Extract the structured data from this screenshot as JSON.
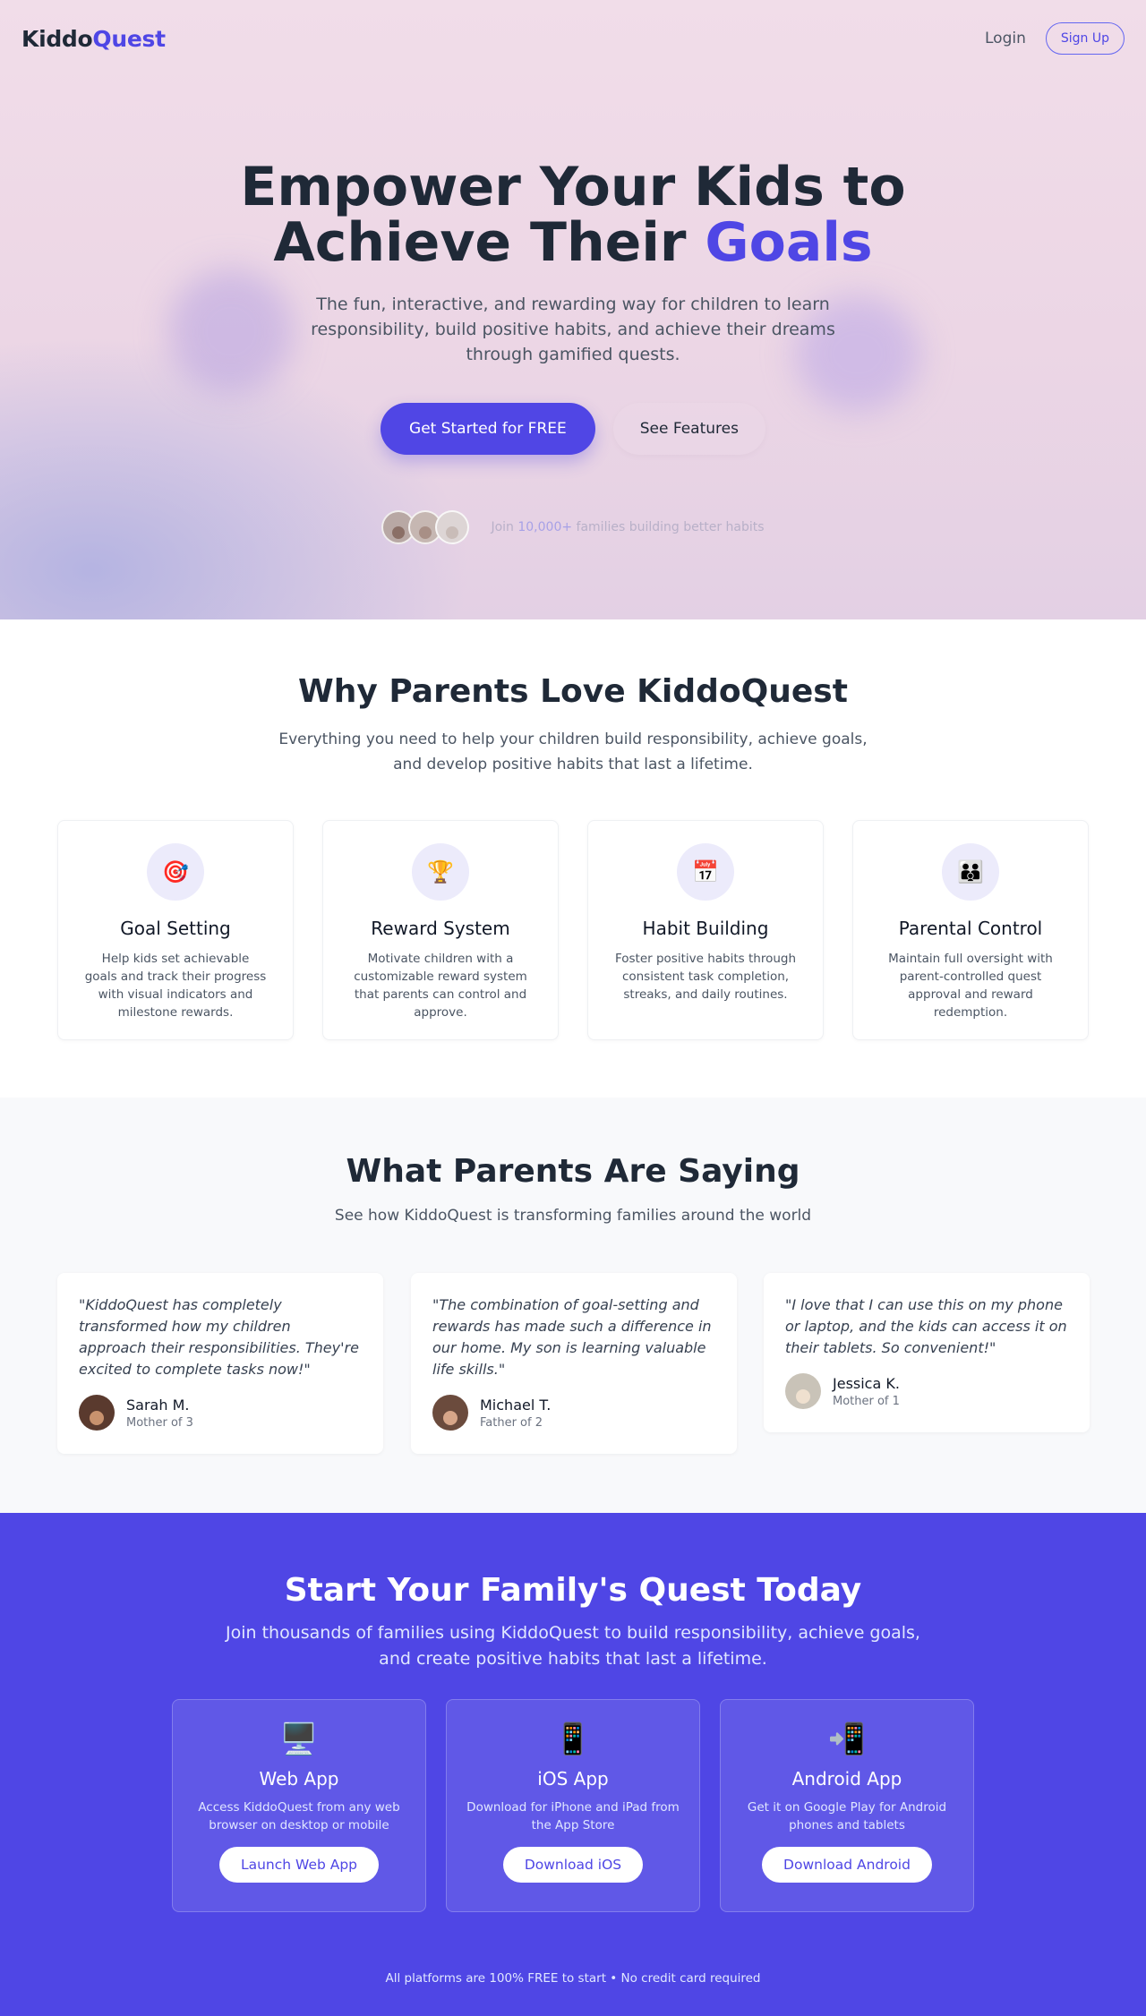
{
  "brand": {
    "part1": "Kiddo",
    "part2": "Quest"
  },
  "nav": {
    "login": "Login",
    "signup": "Sign Up"
  },
  "hero": {
    "title_line1": "Empower Your Kids to",
    "title_line2_prefix": "Achieve Their ",
    "title_accent": "Goals",
    "subtitle": "The fun, interactive, and rewarding way for children to learn responsibility, build positive habits, and achieve their dreams through gamified quests.",
    "cta_primary": "Get Started for FREE",
    "cta_secondary": "See Features",
    "proof_prefix": "Join ",
    "proof_number": "10,000+",
    "proof_suffix": " families building better habits"
  },
  "features": {
    "title": "Why Parents Love KiddoQuest",
    "subtitle": "Everything you need to help your children build responsibility, achieve goals, and develop positive habits that last a lifetime.",
    "items": [
      {
        "icon": "🎯",
        "title": "Goal Setting",
        "desc": "Help kids set achievable goals and track their progress with visual indicators and milestone rewards."
      },
      {
        "icon": "🏆",
        "title": "Reward System",
        "desc": "Motivate children with a customizable reward system that parents can control and approve."
      },
      {
        "icon": "📅",
        "title": "Habit Building",
        "desc": "Foster positive habits through consistent task completion, streaks, and daily routines."
      },
      {
        "icon": "👪",
        "title": "Parental Control",
        "desc": "Maintain full oversight with parent-controlled quest approval and reward redemption."
      }
    ]
  },
  "testimonials": {
    "title": "What Parents Are Saying",
    "subtitle": "See how KiddoQuest is transforming families around the world",
    "items": [
      {
        "quote": "\"KiddoQuest has completely transformed how my children approach their responsibilities. They're excited to complete tasks now!\"",
        "name": "Sarah M.",
        "role": "Mother of 3"
      },
      {
        "quote": "\"The combination of goal-setting and rewards has made such a difference in our home. My son is learning valuable life skills.\"",
        "name": "Michael T.",
        "role": "Father of 2"
      },
      {
        "quote": "\"I love that I can use this on my phone or laptop, and the kids can access it on their tablets. So convenient!\"",
        "name": "Jessica K.",
        "role": "Mother of 1"
      }
    ]
  },
  "cta": {
    "title": "Start Your Family's Quest Today",
    "subtitle": "Join thousands of families using KiddoQuest to build responsibility, achieve goals, and create positive habits that last a lifetime.",
    "platforms": [
      {
        "icon": "🖥️",
        "title": "Web App",
        "desc": "Access KiddoQuest from any web browser on desktop or mobile",
        "button": "Launch Web App"
      },
      {
        "icon": "📱",
        "title": "iOS App",
        "desc": "Download for iPhone and iPad from the App Store",
        "button": "Download iOS"
      },
      {
        "icon": "📲",
        "title": "Android App",
        "desc": "Get it on Google Play for Android phones and tablets",
        "button": "Download Android"
      }
    ],
    "footnote": "All platforms are 100% FREE to start • No credit card required"
  },
  "colors": {
    "accent": "#4f46e5",
    "text": "#1f2937",
    "muted": "#4b5563",
    "cta_bg": "#4f46e5"
  }
}
